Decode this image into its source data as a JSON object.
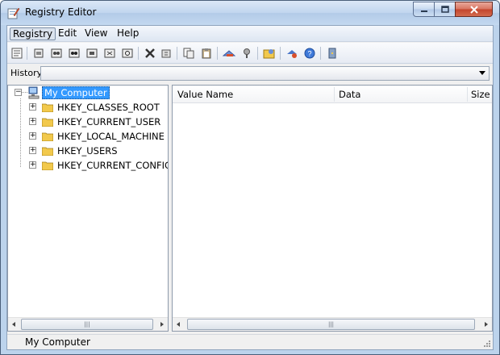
{
  "window": {
    "title": "Registry Editor"
  },
  "menu": [
    {
      "label": "Registry",
      "active": true
    },
    {
      "label": "Edit",
      "active": false
    },
    {
      "label": "View",
      "active": false
    },
    {
      "label": "Help",
      "active": false
    }
  ],
  "toolbar_icons": [
    "properties-icon",
    "open-local-icon",
    "open-remote-icon",
    "open-remote-2-icon",
    "connect-icon",
    "disconnect-icon",
    "find-icon",
    "delete-icon",
    "rename-icon",
    "copy-icon",
    "paste-icon",
    "export-icon",
    "import-icon",
    "favorites-icon",
    "permissions-icon",
    "help-icon",
    "exit-icon"
  ],
  "history": {
    "label": "History:",
    "value": ""
  },
  "tree": {
    "root": {
      "label": "My Computer",
      "selected": true
    },
    "children": [
      {
        "label": "HKEY_CLASSES_ROOT"
      },
      {
        "label": "HKEY_CURRENT_USER"
      },
      {
        "label": "HKEY_LOCAL_MACHINE"
      },
      {
        "label": "HKEY_USERS"
      },
      {
        "label": "HKEY_CURRENT_CONFIG"
      }
    ]
  },
  "list": {
    "columns": [
      "Value Name",
      "Data",
      "Size"
    ],
    "rows": []
  },
  "status": {
    "text": "My Computer"
  },
  "colors": {
    "selection": "#3399ff",
    "folder": "#f2c94c",
    "close_button": "#c3442c"
  }
}
